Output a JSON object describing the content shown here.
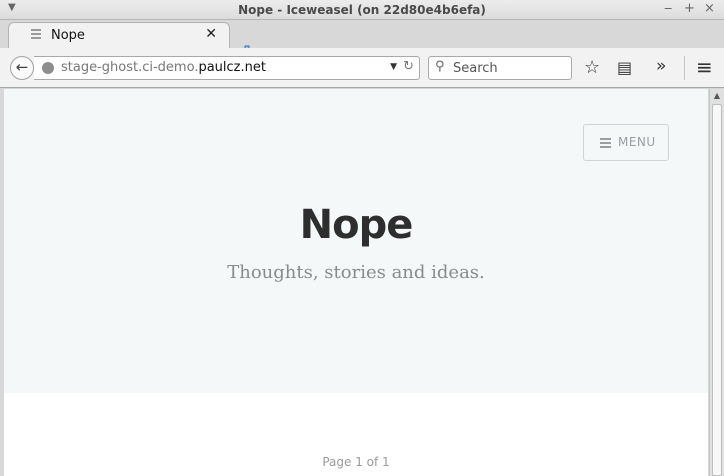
{
  "window": {
    "title": "Nope - Iceweasel (on 22d80e4b6efa)",
    "minimize_glyph": "‒",
    "maximize_glyph": "+",
    "close_glyph": "×",
    "menu_glyph": "▼"
  },
  "tabs": [
    {
      "label": "Nope",
      "close_glyph": "✕"
    }
  ],
  "navbar": {
    "url_prefix": "stage-ghost.ci-demo.",
    "url_domain": "paulcz.net",
    "search_placeholder": "Search",
    "back_glyph": "←",
    "reload_glyph": "↻",
    "dropdown_glyph": "▼",
    "search_glyph": "⚲",
    "bookmark_glyph": "☆",
    "library_glyph": "▤",
    "overflow_glyph": "»",
    "menu_glyph": "≡"
  },
  "page": {
    "menu_label": "MENU",
    "blog_title": "Nope",
    "blog_description": "Thoughts, stories and ideas.",
    "pagination": "Page 1 of 1"
  },
  "scrollbar": {
    "up_glyph": "▲"
  },
  "colors": {
    "hero_background": "#f5f8f9",
    "title_text": "#2e2e2e",
    "muted_text": "#8a8a8a"
  }
}
